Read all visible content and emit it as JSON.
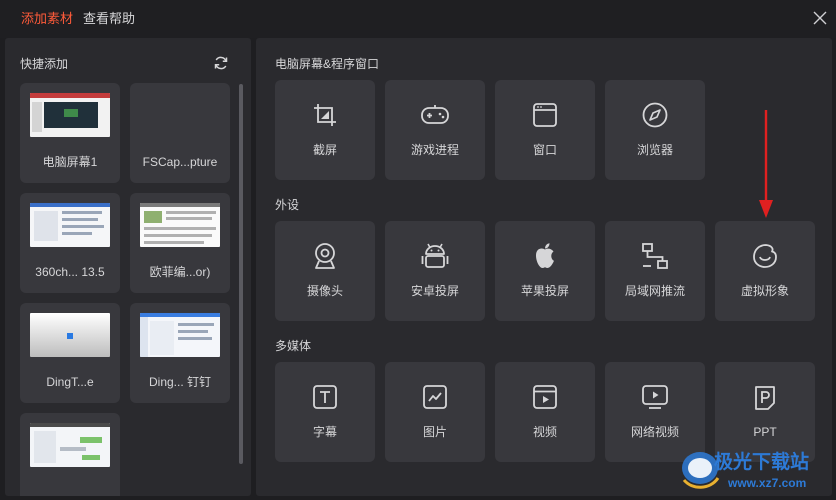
{
  "header": {
    "tabs": [
      {
        "label": "添加素材",
        "active": true
      },
      {
        "label": "查看帮助",
        "active": false
      }
    ],
    "close_icon": "close-icon"
  },
  "quick_add": {
    "title": "快捷添加",
    "refresh_icon": "refresh-icon",
    "items": [
      {
        "label": "电脑屏幕1"
      },
      {
        "label": "FSCap...pture"
      },
      {
        "label": "360ch... 13.5"
      },
      {
        "label": "欧菲编...or)"
      },
      {
        "label": "DingT...e"
      },
      {
        "label": "Ding... 钉钉"
      },
      {
        "label": ""
      }
    ]
  },
  "sections": [
    {
      "title": "电脑屏幕&程序窗口",
      "tiles": [
        {
          "label": "截屏",
          "icon": "screenshot-icon"
        },
        {
          "label": "游戏进程",
          "icon": "gamepad-icon"
        },
        {
          "label": "窗口",
          "icon": "window-icon"
        },
        {
          "label": "浏览器",
          "icon": "compass-icon"
        }
      ]
    },
    {
      "title": "外设",
      "tiles": [
        {
          "label": "摄像头",
          "icon": "webcam-icon"
        },
        {
          "label": "安卓投屏",
          "icon": "android-icon"
        },
        {
          "label": "苹果投屏",
          "icon": "apple-icon"
        },
        {
          "label": "局域网推流",
          "icon": "network-icon"
        },
        {
          "label": "虚拟形象",
          "icon": "avatar-icon"
        }
      ]
    },
    {
      "title": "多媒体",
      "tiles": [
        {
          "label": "字幕",
          "icon": "subtitle-icon"
        },
        {
          "label": "图片",
          "icon": "image-icon"
        },
        {
          "label": "视频",
          "icon": "video-icon"
        },
        {
          "label": "网络视频",
          "icon": "online-video-icon"
        },
        {
          "label": "PPT",
          "icon": "ppt-icon"
        }
      ]
    }
  ],
  "watermark": {
    "text": "极光下载站",
    "url": "www.xz7.com"
  },
  "colors": {
    "accent": "#ff5b3a",
    "annotation_arrow": "#e02020",
    "watermark": "#2d7ad6"
  }
}
